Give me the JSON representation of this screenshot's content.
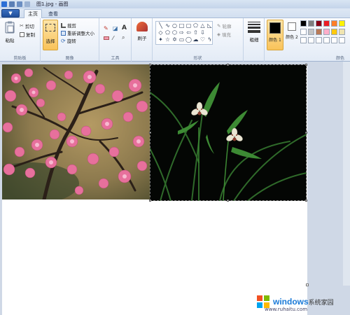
{
  "window": {
    "title": "图1.jpg - 画图"
  },
  "tabs": {
    "menu_label": "▼",
    "home": "主页",
    "view": "查看"
  },
  "ribbon": {
    "clipboard": {
      "paste": "粘贴",
      "cut": "剪切",
      "copy": "复制",
      "group": "剪贴板"
    },
    "image": {
      "select": "选择",
      "crop": "裁剪",
      "resize": "重新调整大小",
      "rotate": "旋转",
      "group": "图像"
    },
    "tools": {
      "text_icon": "A",
      "group": "工具"
    },
    "brushes": {
      "label": "刷子"
    },
    "shapes": {
      "outline": "轮廓",
      "fill": "填充",
      "group": "形状"
    },
    "size": {
      "label": "粗细"
    },
    "colors": {
      "color1": "颜色 1",
      "color2": "颜色 2",
      "group": "颜色",
      "palette_row1": [
        "#000000",
        "#7f7f7f",
        "#880015",
        "#ed1c24",
        "#ff7f27",
        "#fff200"
      ],
      "palette_row2": [
        "#ffffff",
        "#c3c3c3",
        "#b97a57",
        "#ffaec9",
        "#ffc90e",
        "#efe4b0"
      ],
      "palette_row3": [
        "#ffffff",
        "#ffffff",
        "#ffffff",
        "#ffffff",
        "#ffffff",
        "#ffffff"
      ]
    }
  },
  "watermark": {
    "brand": "windows",
    "brand_suffix": "系统家园",
    "url": "www.ruhaitu.com"
  }
}
